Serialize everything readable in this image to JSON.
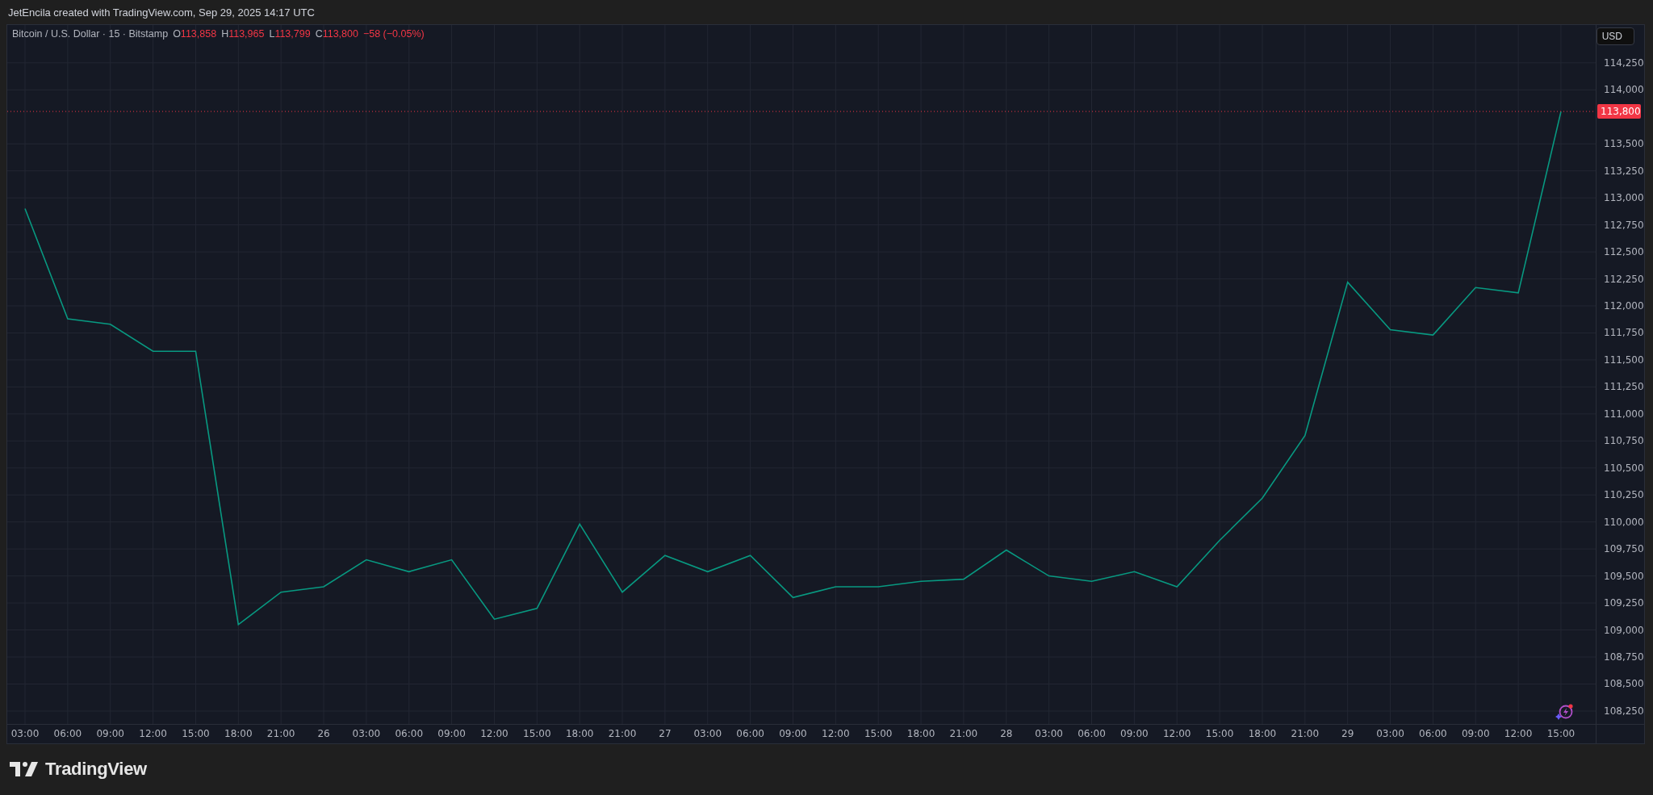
{
  "header": {
    "caption": "JetEncila created with TradingView.com, Sep 29, 2025 14:17 UTC"
  },
  "legend": {
    "symbol": "Bitcoin / U.S. Dollar · 15 · Bitstamp",
    "color": "#f23645",
    "ohlc": [
      {
        "label": "O",
        "value": "113,858"
      },
      {
        "label": "H",
        "value": "113,965"
      },
      {
        "label": "L",
        "value": "113,799"
      },
      {
        "label": "C",
        "value": "113,800"
      }
    ],
    "change": "−58 (−0.05%)"
  },
  "currency_button": "USD",
  "chart_data": {
    "type": "line",
    "grid": true,
    "categories": [
      "03:00",
      "06:00",
      "09:00",
      "12:00",
      "15:00",
      "18:00",
      "21:00",
      "26",
      "03:00",
      "06:00",
      "09:00",
      "12:00",
      "15:00",
      "18:00",
      "21:00",
      "27",
      "03:00",
      "06:00",
      "09:00",
      "12:00",
      "15:00",
      "18:00",
      "21:00",
      "28",
      "03:00",
      "06:00",
      "09:00",
      "12:00",
      "15:00",
      "18:00",
      "21:00",
      "29",
      "03:00",
      "06:00",
      "09:00",
      "12:00",
      "15:00"
    ],
    "series": [
      {
        "color": "#089981",
        "values": [
          112900,
          111880,
          111830,
          111580,
          111580,
          109050,
          109350,
          109400,
          109650,
          109540,
          109650,
          109100,
          109200,
          109980,
          109350,
          109690,
          109540,
          109690,
          109300,
          109400,
          109400,
          109450,
          109470,
          109740,
          109500,
          109450,
          109540,
          109400,
          109830,
          110220,
          110800,
          112220,
          111780,
          111730,
          112170,
          112120,
          113800
        ]
      }
    ],
    "ylim": [
      108130,
      114600
    ],
    "yticks": [
      {
        "value": 108250,
        "label": "108,250"
      },
      {
        "value": 108500,
        "label": "108,500"
      },
      {
        "value": 108750,
        "label": "108,750"
      },
      {
        "value": 109000,
        "label": "109,000"
      },
      {
        "value": 109250,
        "label": "109,250"
      },
      {
        "value": 109500,
        "label": "109,500"
      },
      {
        "value": 109750,
        "label": "109,750"
      },
      {
        "value": 110000,
        "label": "110,000"
      },
      {
        "value": 110250,
        "label": "110,250"
      },
      {
        "value": 110500,
        "label": "110,500"
      },
      {
        "value": 110750,
        "label": "110,750"
      },
      {
        "value": 111000,
        "label": "111,000"
      },
      {
        "value": 111250,
        "label": "111,250"
      },
      {
        "value": 111500,
        "label": "111,500"
      },
      {
        "value": 111750,
        "label": "111,750"
      },
      {
        "value": 112000,
        "label": "112,000"
      },
      {
        "value": 112250,
        "label": "112,250"
      },
      {
        "value": 112500,
        "label": "112,500"
      },
      {
        "value": 112750,
        "label": "112,750"
      },
      {
        "value": 113000,
        "label": "113,000"
      },
      {
        "value": 113250,
        "label": "113,250"
      },
      {
        "value": 113500,
        "label": "113,500"
      },
      {
        "value": 114000,
        "label": "114,000"
      },
      {
        "value": 114250,
        "label": "114,250"
      }
    ],
    "ref_lines": [
      {
        "axis": "y",
        "value": 113800,
        "label": "113,800",
        "color": "#f23645"
      }
    ]
  },
  "footer": {
    "brand": "TradingView"
  }
}
